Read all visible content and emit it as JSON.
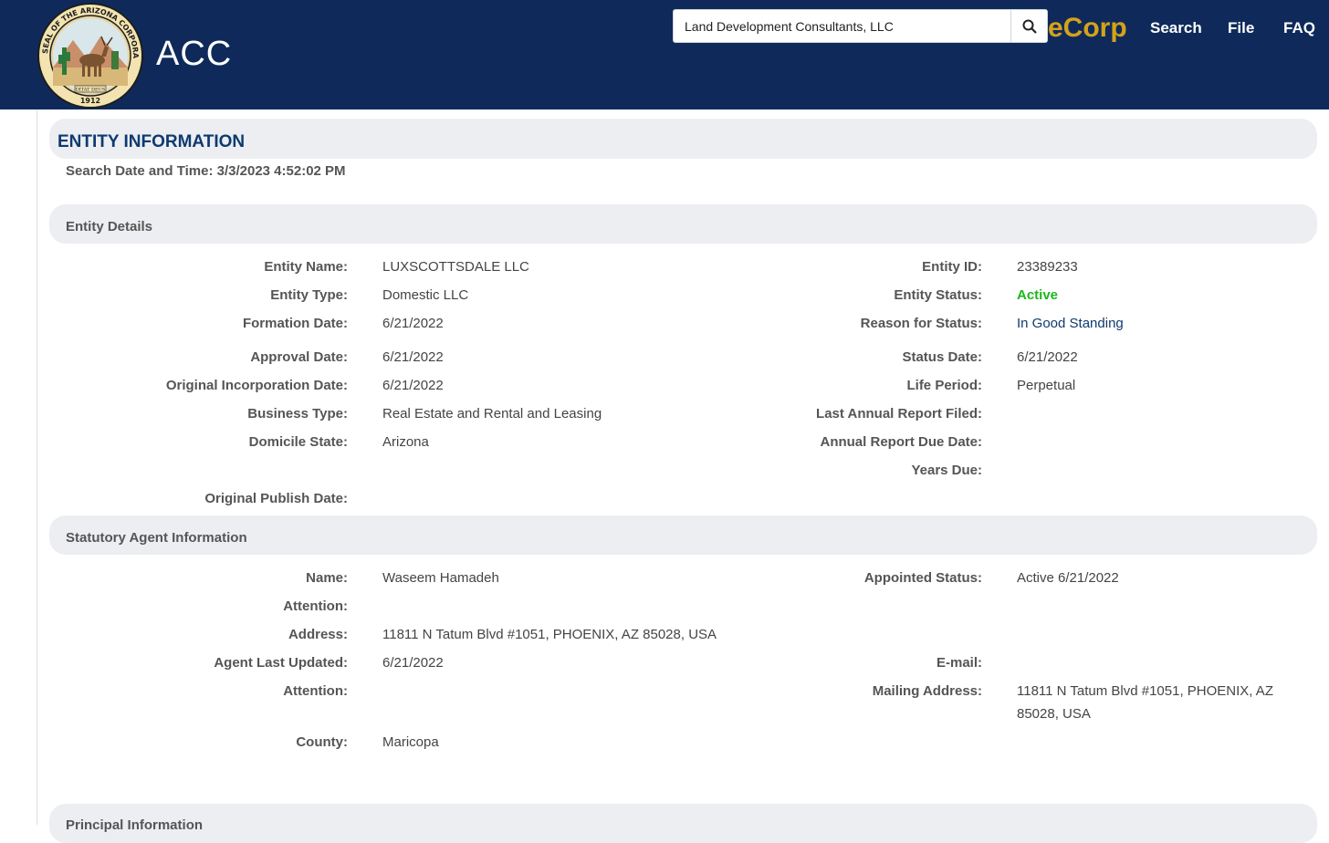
{
  "header": {
    "brand": "ACC",
    "seal_text_top": "SEAL OF THE ARIZONA CORPORATION COMMISSION",
    "seal_motto": "DITAT DEUS",
    "seal_year": "1912",
    "search_value": "Land Development Consultants, LLC",
    "app_name": "eCorp",
    "nav": [
      "Search",
      "File",
      "FAQ"
    ],
    "colors": {
      "header_bg": "#0f2a5a",
      "brand_gold": "#d4a21a"
    }
  },
  "entity_info": {
    "title": "ENTITY INFORMATION",
    "search_date": "Search Date and Time: 3/3/2023 4:52:02 PM"
  },
  "entity_details": {
    "section_title": "Entity Details",
    "left": [
      {
        "label": "Entity Name:",
        "value": "LUXSCOTTSDALE LLC"
      },
      {
        "label": "Entity Type:",
        "value": "Domestic LLC"
      },
      {
        "label": "Formation Date:",
        "value": "6/21/2022"
      },
      {
        "label": "Approval Date:",
        "value": "6/21/2022"
      },
      {
        "label": "Original Incorporation Date:",
        "value": "6/21/2022"
      },
      {
        "label": "Business Type:",
        "value": "Real Estate and Rental and Leasing"
      },
      {
        "label": "Domicile State:",
        "value": "Arizona"
      },
      {
        "label": "Original Publish Date:",
        "value": ""
      }
    ],
    "right": [
      {
        "label": "Entity ID:",
        "value": "23389233"
      },
      {
        "label": "Entity Status:",
        "value": "Active"
      },
      {
        "label": "Reason for Status:",
        "value": "In Good Standing"
      },
      {
        "label": "Status Date:",
        "value": "6/21/2022"
      },
      {
        "label": "Life Period:",
        "value": "Perpetual"
      },
      {
        "label": "Last Annual Report Filed:",
        "value": ""
      },
      {
        "label": "Annual Report Due Date:",
        "value": ""
      },
      {
        "label": "Years Due:",
        "value": ""
      }
    ]
  },
  "statutory_agent": {
    "section_title": "Statutory Agent Information",
    "left": [
      {
        "label": "Name:",
        "value": "Waseem Hamadeh"
      },
      {
        "label": "Attention:",
        "value": ""
      },
      {
        "label": "Address:",
        "value": "11811 N Tatum Blvd #1051, PHOENIX, AZ 85028, USA"
      },
      {
        "label": "Agent Last Updated:",
        "value": "6/21/2022"
      },
      {
        "label": "Attention:",
        "value": ""
      },
      {
        "label": "County:",
        "value": "Maricopa"
      }
    ],
    "right": [
      {
        "label": "Appointed Status:",
        "value": "Active 6/21/2022"
      },
      {
        "label": "E-mail:",
        "value": ""
      },
      {
        "label": "Mailing Address:",
        "value": "11811 N Tatum Blvd #1051, PHOENIX, AZ 85028, USA"
      }
    ]
  },
  "principal_info": {
    "section_title": "Principal Information"
  }
}
